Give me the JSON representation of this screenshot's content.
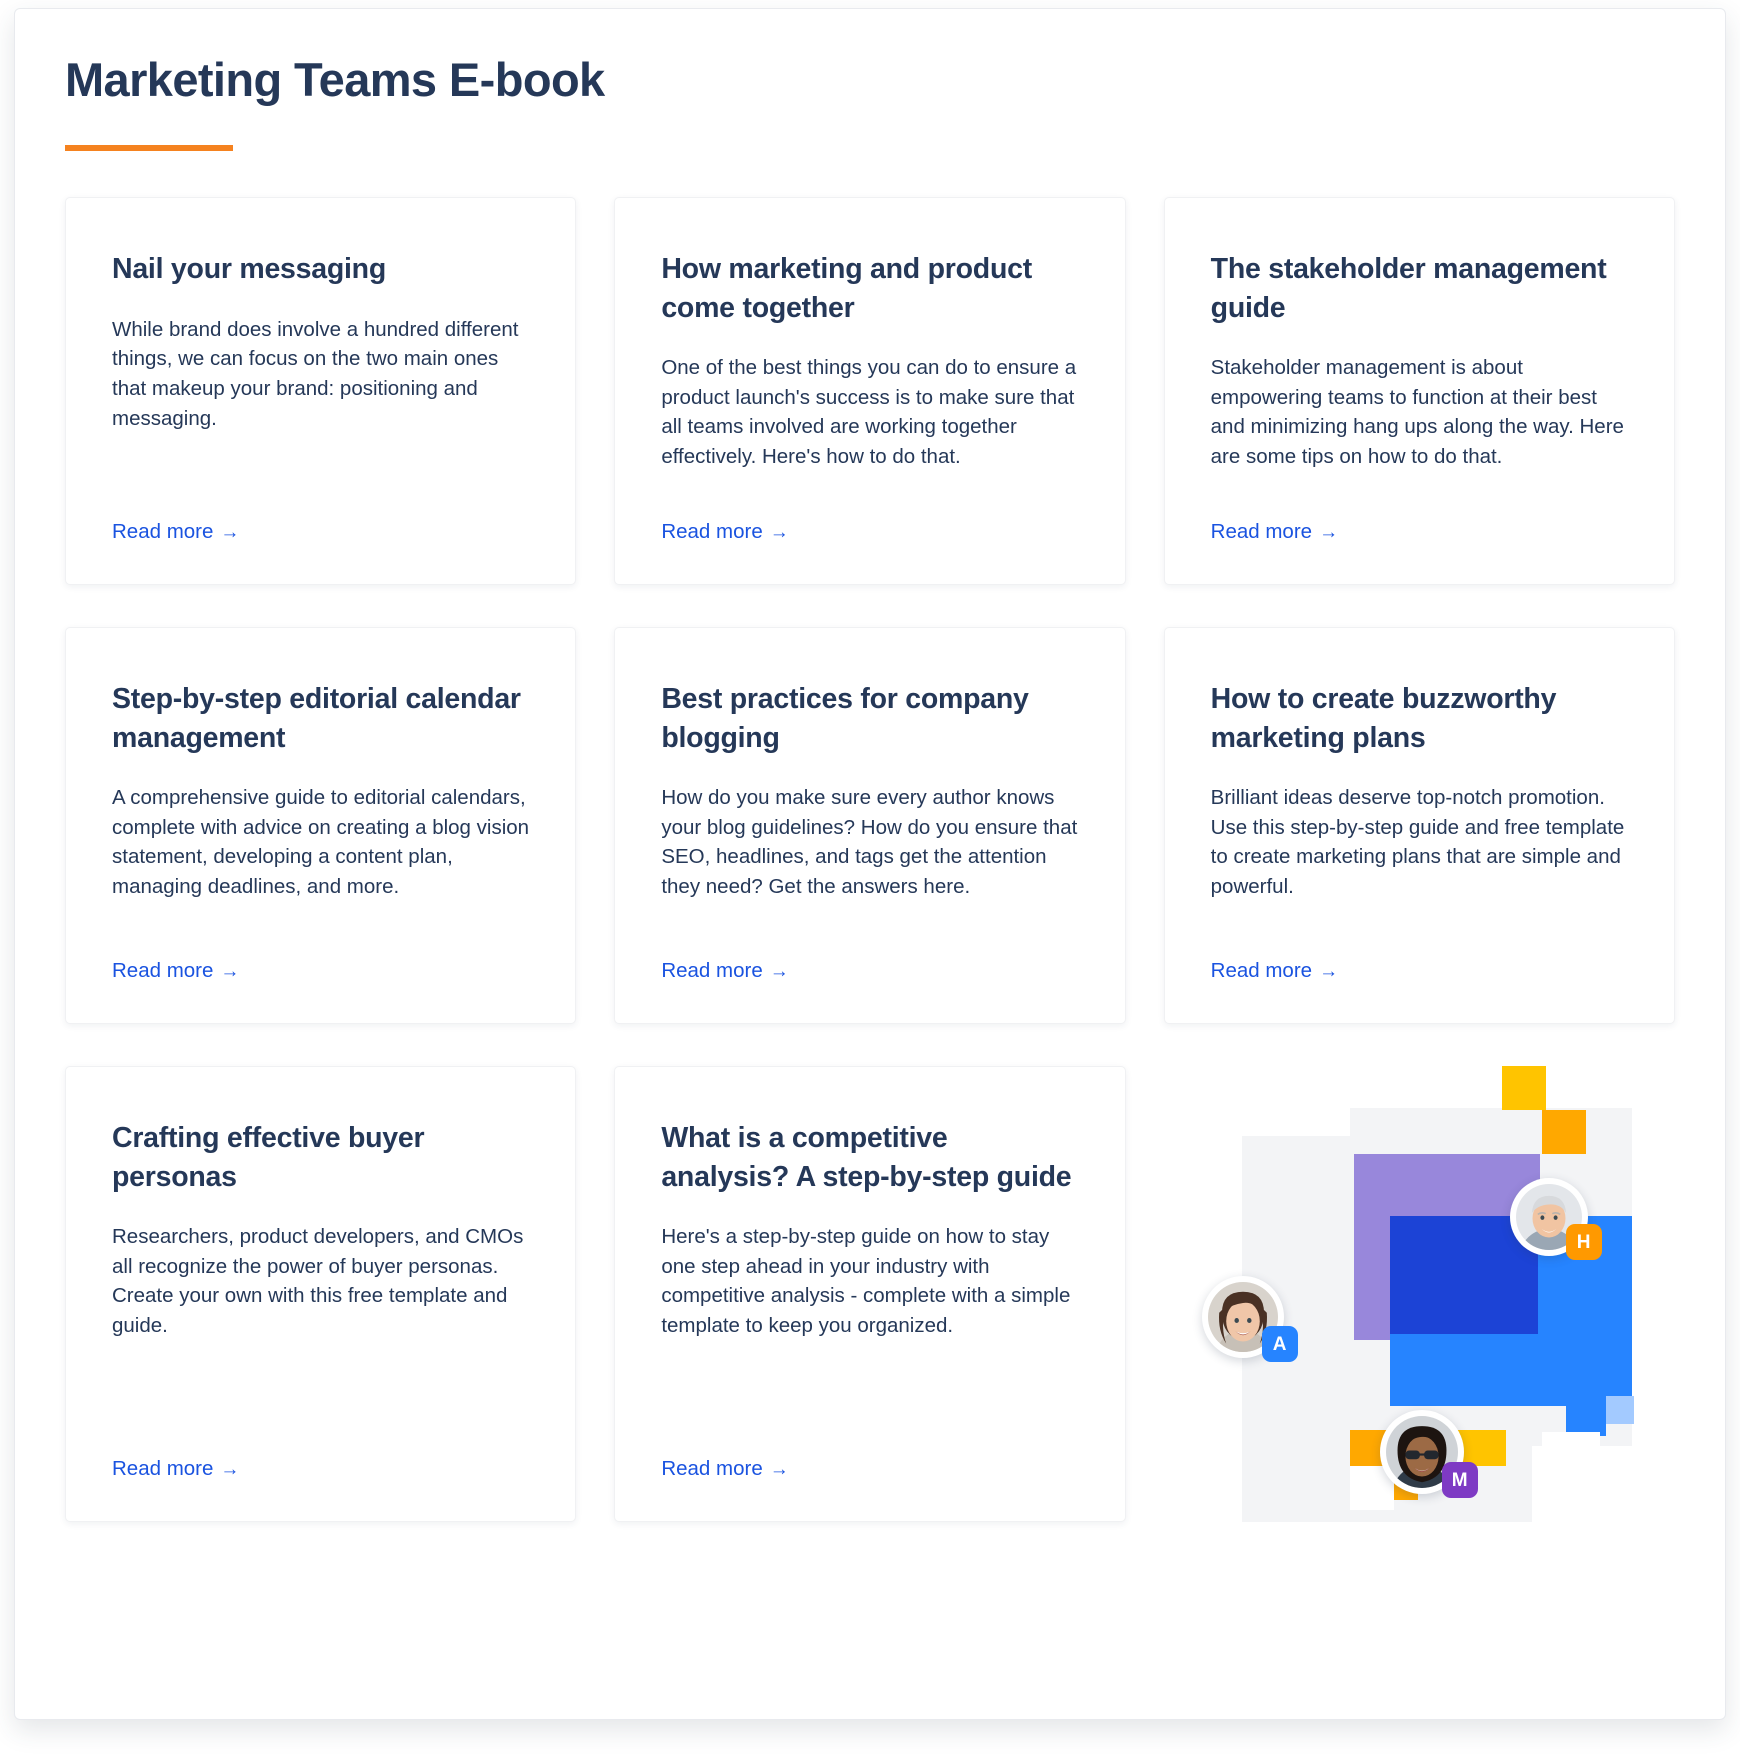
{
  "header": {
    "title": "Marketing Teams E-book",
    "accent_color": "#f5821f",
    "title_color": "#253858"
  },
  "link_label": "Read more",
  "link_arrow": "→",
  "link_color": "#1a53e0",
  "cards": [
    {
      "title": "Nail your messaging",
      "body": "While brand does involve a hundred different things, we can focus on the two main ones that makeup your brand: positioning and messaging.",
      "read_more": "Read more"
    },
    {
      "title": "How marketing and product come together",
      "body": "One of the best things you can do to ensure a product launch's success is to make sure that all teams involved are working together effectively. Here's how to do that.",
      "read_more": "Read more"
    },
    {
      "title": "The stakeholder management guide",
      "body": "Stakeholder management is about empowering teams to function at their best and minimizing hang ups along the way. Here are some tips on how to do that.",
      "read_more": "Read more"
    },
    {
      "title": "Step-by-step editorial calendar management",
      "body": "A comprehensive guide to editorial calendars, complete with advice on creating a blog vision statement, developing a content plan, managing deadlines, and more.",
      "read_more": "Read more"
    },
    {
      "title": "Best practices for company blogging",
      "body": "How do you make sure every author knows your blog guidelines? How do you ensure that SEO, headlines, and tags get the attention they need? Get the answers here.",
      "read_more": "Read more"
    },
    {
      "title": "How to create buzzworthy marketing plans",
      "body": "Brilliant ideas deserve top-notch promotion. Use this step-by-step guide and free template to create marketing plans that are simple and powerful.",
      "read_more": "Read more"
    },
    {
      "title": "Crafting effective buyer personas",
      "body": "Researchers, product developers, and CMOs all recognize the power of buyer personas. Create your own with this free template and guide.",
      "read_more": "Read more"
    },
    {
      "title": "What is a competitive analysis? A step-by-step guide",
      "body": "Here's a step-by-step guide on how to stay one step ahead in your industry with competitive analysis - complete with a simple template to keep you organized.",
      "read_more": "Read more"
    }
  ],
  "illustration": {
    "avatars": [
      {
        "initial": "A",
        "badge_color": "#2684ff"
      },
      {
        "initial": "H",
        "badge_color": "#ff9900"
      },
      {
        "initial": "M",
        "badge_color": "#7e3ac4"
      }
    ],
    "block_colors": {
      "yellow": "#ffc400",
      "orange": "#ffa800",
      "purple": "#7e68d3",
      "blue_light": "#2684ff",
      "blue_dark": "#1c43d6",
      "blue_pale": "#a3caff",
      "grey": "#f3f4f6"
    }
  }
}
